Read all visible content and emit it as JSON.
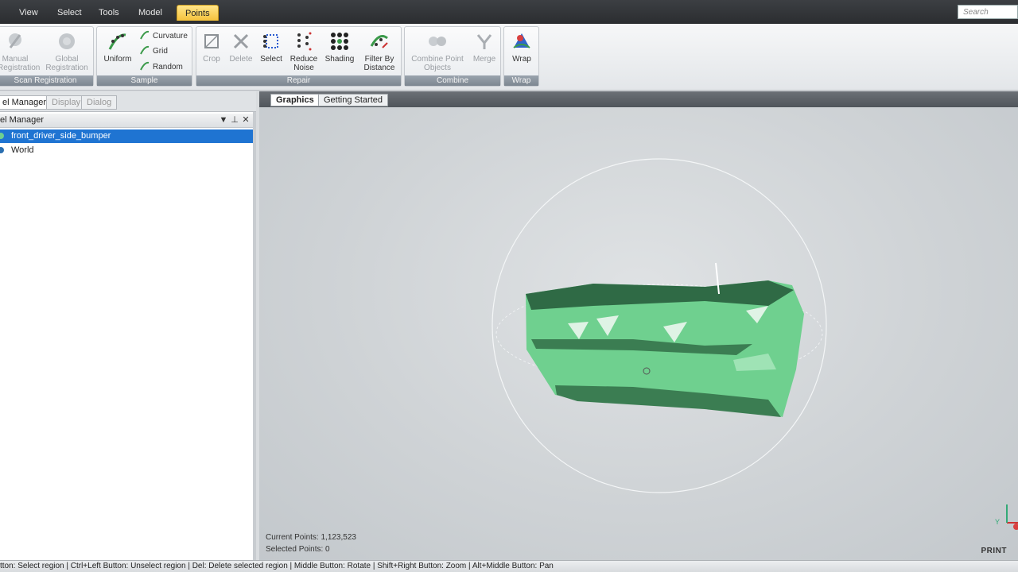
{
  "menu": {
    "tabs": [
      "View",
      "Select",
      "Tools",
      "Model",
      "Points"
    ],
    "active_tab": "Points",
    "search_placeholder": "Search"
  },
  "ribbon": {
    "groups": {
      "scan_registration": {
        "title": "Scan Registration",
        "buttons": [
          "Manual Registration",
          "Global Registration"
        ]
      },
      "sample": {
        "title": "Sample",
        "uniform": "Uniform",
        "curvature": "Curvature",
        "grid": "Grid",
        "random": "Random"
      },
      "repair": {
        "title": "Repair",
        "crop": "Crop",
        "delete": "Delete",
        "select": "Select",
        "reduce_noise": "Reduce Noise",
        "shading": "Shading",
        "filter_by_distance": "Filter By Distance"
      },
      "combine": {
        "title": "Combine",
        "combine_point_objects": "Combine Point Objects",
        "merge": "Merge"
      },
      "wrap": {
        "title": "Wrap",
        "wrap": "Wrap"
      }
    }
  },
  "left_panel": {
    "tabs": [
      "el Manager",
      "Display",
      "Dialog"
    ],
    "header": "el Manager",
    "tree": [
      "front_driver_side_bumper",
      "World"
    ]
  },
  "viewport": {
    "tabs": [
      "Graphics",
      "Getting Started"
    ],
    "current_points": "Current Points: 1,123,523",
    "selected_points": "Selected Points: 0",
    "axis_label": "Y"
  },
  "status": "tton: Select region | Ctrl+Left Button: Unselect region | Del: Delete selected region | Middle Button: Rotate | Shift+Right Button: Zoom | Alt+Middle Button: Pan",
  "watermark": "PRINT",
  "colors": {
    "accent": "#1f74d2",
    "active_tab": "#f5c23b",
    "model": "#6fd08f"
  }
}
